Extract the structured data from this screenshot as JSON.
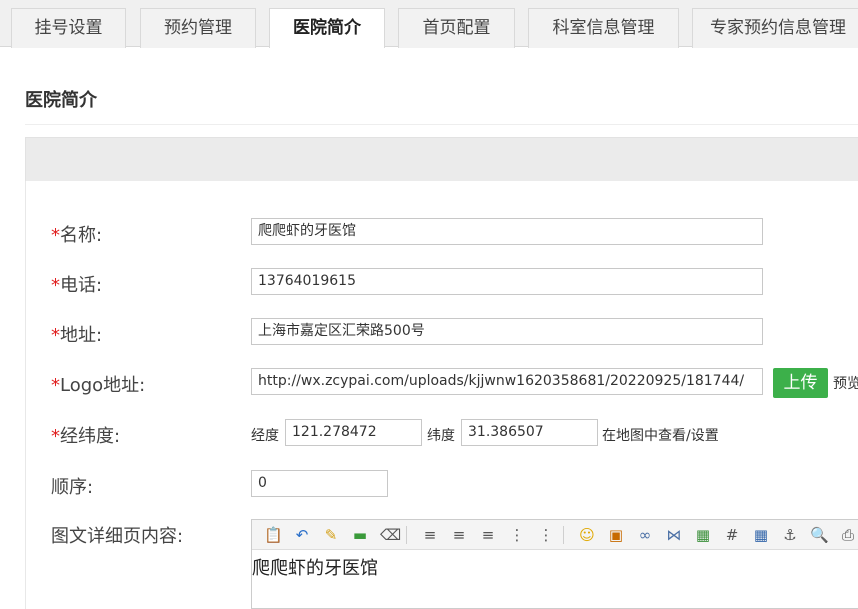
{
  "tabs": [
    {
      "label": "挂号设置",
      "active": false
    },
    {
      "label": "预约管理",
      "active": false
    },
    {
      "label": "医院简介",
      "active": true
    },
    {
      "label": "首页配置",
      "active": false
    },
    {
      "label": "科室信息管理",
      "active": false
    },
    {
      "label": "专家预约信息管理",
      "active": false
    }
  ],
  "page": {
    "title": "医院简介"
  },
  "form": {
    "required_mark": "*",
    "name": {
      "label": "名称:",
      "value": "爬爬虾的牙医馆"
    },
    "phone": {
      "label": "电话:",
      "value": "13764019615"
    },
    "address": {
      "label": "地址:",
      "value": "上海市嘉定区汇荣路500号"
    },
    "logo": {
      "label": "Logo地址:",
      "value": "http://wx.zcypai.com/uploads/kjjwnw1620358681/20220925/181744/",
      "upload_label": "上传",
      "preview_label": "预览"
    },
    "coords": {
      "label": "经纬度:",
      "lng_label": "经度",
      "lng_value": "121.278472",
      "lat_label": "纬度",
      "lat_value": "31.386507",
      "map_link": "在地图中查看/设置"
    },
    "order": {
      "label": "顺序:",
      "value": "0"
    },
    "detail": {
      "label": "图文详细页内容:",
      "content": "爬爬虾的牙医馆"
    }
  },
  "editor_toolbar": [
    "paste-icon",
    "undo-icon",
    "clear-format-icon",
    "insert-line-icon",
    "eraser-icon",
    "align-left-icon",
    "align-center-icon",
    "align-right-icon",
    "ordered-list-icon",
    "unordered-list-icon",
    "emoji-icon",
    "image-insert-icon",
    "link-icon",
    "unlink-icon",
    "picture-icon",
    "anchor-grid-icon",
    "table-icon",
    "anchor-icon",
    "preview-icon",
    "print-icon"
  ]
}
